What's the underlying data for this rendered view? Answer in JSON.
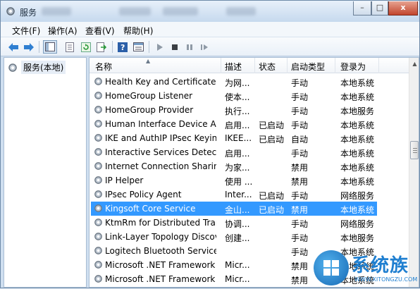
{
  "window": {
    "title": "服务"
  },
  "caption_buttons": {
    "minimize": "–",
    "maximize": "□",
    "close": "x"
  },
  "menu": [
    "文件(F)",
    "操作(A)",
    "查看(V)",
    "帮助(H)"
  ],
  "toolbar_icons": [
    "back-arrow-icon",
    "forward-arrow-icon",
    "console-tree-icon",
    "properties-list-icon",
    "refresh-icon",
    "export-list-icon",
    "help-icon",
    "details-view-icon",
    "start-service-icon",
    "stop-service-icon",
    "pause-service-icon",
    "restart-service-icon"
  ],
  "tree": {
    "item": "服务(本地)"
  },
  "columns": {
    "name": "名称",
    "desc": "描述",
    "state": "状态",
    "start_type": "启动类型",
    "logon": "登录为"
  },
  "services": [
    {
      "name": "Health Key and Certificate ...",
      "desc": "为网...",
      "state": "",
      "start_type": "手动",
      "logon": "本地系统"
    },
    {
      "name": "HomeGroup Listener",
      "desc": "使本...",
      "state": "",
      "start_type": "手动",
      "logon": "本地系统"
    },
    {
      "name": "HomeGroup Provider",
      "desc": "执行...",
      "state": "",
      "start_type": "手动",
      "logon": "本地服务"
    },
    {
      "name": "Human Interface Device Acc...",
      "desc": "启用...",
      "state": "已启动",
      "start_type": "手动",
      "logon": "本地系统"
    },
    {
      "name": "IKE and AuthIP IPsec Keyin...",
      "desc": "IKEE...",
      "state": "已启动",
      "start_type": "自动",
      "logon": "本地系统"
    },
    {
      "name": "Interactive Services Detection",
      "desc": "启用...",
      "state": "",
      "start_type": "手动",
      "logon": "本地系统"
    },
    {
      "name": "Internet Connection Sharing...",
      "desc": "为家...",
      "state": "",
      "start_type": "禁用",
      "logon": "本地系统"
    },
    {
      "name": "IP Helper",
      "desc": "使用 ...",
      "state": "",
      "start_type": "禁用",
      "logon": "本地系统"
    },
    {
      "name": "IPsec Policy Agent",
      "desc": "Inter...",
      "state": "已启动",
      "start_type": "手动",
      "logon": "网络服务"
    },
    {
      "name": "Kingsoft Core Service",
      "desc": "金山...",
      "state": "已启动",
      "start_type": "禁用",
      "logon": "本地系统",
      "selected": true
    },
    {
      "name": "KtmRm for Distributed Tran...",
      "desc": "协调...",
      "state": "",
      "start_type": "手动",
      "logon": "网络服务"
    },
    {
      "name": "Link-Layer Topology Discov...",
      "desc": "创建...",
      "state": "",
      "start_type": "手动",
      "logon": "本地服务"
    },
    {
      "name": "Logitech Bluetooth Service",
      "desc": "",
      "state": "",
      "start_type": "手动",
      "logon": "本地系统"
    },
    {
      "name": "Microsoft .NET Framework ...",
      "desc": "Micr...",
      "state": "",
      "start_type": "禁用",
      "logon": "本地系统"
    },
    {
      "name": "Microsoft .NET Framework ...",
      "desc": "Micr...",
      "state": "",
      "start_type": "禁用",
      "logon": "本地系统"
    }
  ],
  "watermark": {
    "text": "系统族",
    "url": "WWW.XITONGZU.COM"
  },
  "colors": {
    "selection": "#3399ff",
    "window_frame": "#cfdff0"
  }
}
